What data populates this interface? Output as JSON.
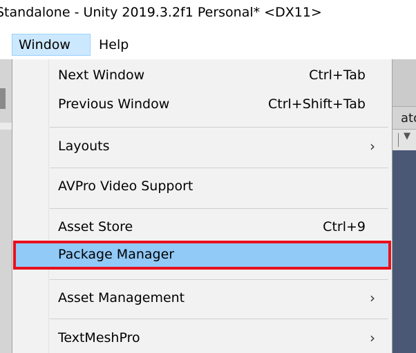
{
  "window": {
    "title": "Standalone - Unity 2019.3.2f1 Personal* <DX11>"
  },
  "menubar": {
    "items": [
      {
        "label": "Window",
        "active": true
      },
      {
        "label": "Help",
        "active": false
      }
    ]
  },
  "background": {
    "right_tab_fragment": "ator",
    "dropdown_arrow": "▼"
  },
  "window_menu": {
    "items": [
      {
        "label": "Next Window",
        "shortcut": "Ctrl+Tab"
      },
      {
        "label": "Previous Window",
        "shortcut": "Ctrl+Shift+Tab"
      },
      {
        "label": "Layouts",
        "submenu": true
      },
      {
        "label": "AVPro Video Support"
      },
      {
        "label": "Asset Store",
        "shortcut": "Ctrl+9"
      },
      {
        "label": "Package Manager",
        "highlighted": true
      },
      {
        "label": "Asset Management",
        "submenu": true
      },
      {
        "label": "TextMeshPro",
        "submenu": true
      }
    ],
    "submenu_glyph": "›"
  },
  "colors": {
    "menu_highlight": "#91c9f7",
    "annotation_box": "#e8101e",
    "scene_view": "#4a5876"
  }
}
